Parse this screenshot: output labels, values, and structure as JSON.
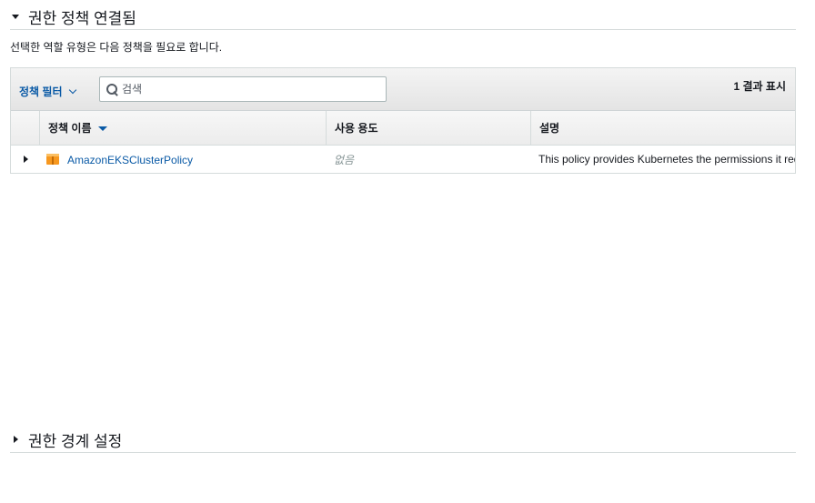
{
  "attached_section": {
    "title": "권한 정책 연결됨",
    "description": "선택한 역할 유형은 다음 정책을 필요로 합니다."
  },
  "toolbar": {
    "filter_label": "정책 필터",
    "search_placeholder": "검색",
    "result_count": "1 결과 표시"
  },
  "table": {
    "columns": [
      "정책 이름",
      "사용 용도",
      "설명"
    ],
    "rows": [
      {
        "name": "AmazonEKSClusterPolicy",
        "usage": "없음",
        "description": "This policy provides Kubernetes the permissions it requires to manage resources on your behalf."
      }
    ]
  },
  "boundary_section": {
    "title": "권한 경계 설정"
  },
  "colors": {
    "link": "#0a5aa6",
    "policy_icon": "#f7981f"
  }
}
